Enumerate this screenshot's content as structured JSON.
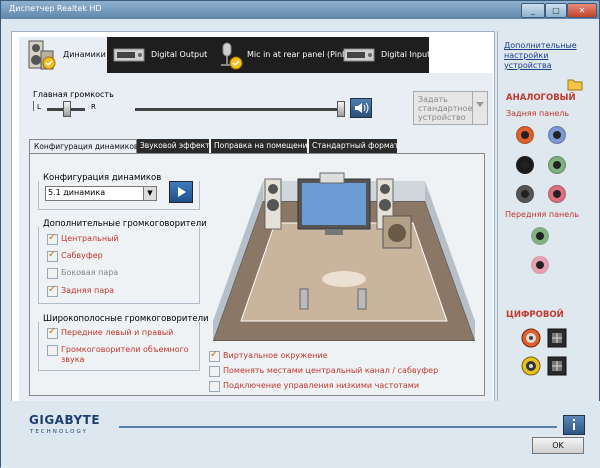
{
  "window": {
    "title": "Диспетчер Realtek HD",
    "buttons": {
      "minimize": "_",
      "maximize": "□",
      "close": "✕"
    }
  },
  "device_tabs": [
    {
      "label": "Динамики",
      "icon": "speakers-icon",
      "active": true
    },
    {
      "label": "Digital Output",
      "icon": "digital-output-device-icon",
      "active": false
    },
    {
      "label": "Mic in at rear panel (Pink)",
      "icon": "microphone-icon",
      "active": false
    },
    {
      "label": "Digital Input",
      "icon": "digital-input-device-icon",
      "active": false
    }
  ],
  "volume": {
    "label": "Главная громкость",
    "left_label": "L",
    "right_label": "R",
    "balance": 0.5,
    "level": 1.0,
    "mute_icon": "speaker-volume-icon",
    "default_device_label": "Задать стандартное устройство"
  },
  "sub_tabs": [
    {
      "label": "Конфигурация динамиков",
      "active": true
    },
    {
      "label": "Звуковой эффект",
      "active": false
    },
    {
      "label": "Поправка на помещение",
      "active": false
    },
    {
      "label": "Стандартный формат",
      "active": false
    }
  ],
  "speaker_config": {
    "title": "Конфигурация динамиков",
    "selected": "5.1 динамика",
    "play_icon": "play-icon"
  },
  "additional_speakers": {
    "title": "Дополнительные громкоговорители",
    "items": [
      {
        "label": "Центральный",
        "checked": true,
        "enabled": true
      },
      {
        "label": "Сабвуфер",
        "checked": true,
        "enabled": true
      },
      {
        "label": "Боковая пара",
        "checked": false,
        "enabled": false
      },
      {
        "label": "Задняя пара",
        "checked": true,
        "enabled": true
      }
    ]
  },
  "fullrange_speakers": {
    "title": "Широкополосные громкоговорители",
    "items": [
      {
        "label": "Передние левый и правый",
        "checked": true
      },
      {
        "label": "Громкоговорители объемного звука",
        "checked": false
      }
    ]
  },
  "bottom_options": [
    {
      "label": "Виртуальное окружение",
      "checked": true
    },
    {
      "label": "Поменять местами центральный канал / сабвуфер",
      "checked": false
    },
    {
      "label": "Подключение управления низкими частотами",
      "checked": false
    }
  ],
  "right_panel": {
    "link": "Дополнительные настройки устройства",
    "analog_title": "АНАЛОГОВЫЙ",
    "rear_panel": "Задняя панель",
    "front_panel": "Передняя панель",
    "digital_title": "ЦИФРОВОЙ",
    "rear_jacks": [
      "#e0612b",
      "#7d9ad6",
      "#1a1a1a",
      "#7fb37f",
      "#555555",
      "#e0707f"
    ],
    "front_jacks": [
      "#7fb37f",
      "#e8a0b0"
    ],
    "folder_icon": "folder-icon"
  },
  "footer": {
    "brand": "GIGABYTE",
    "brand_sub": "TECHNOLOGY",
    "ok_label": "OK",
    "info_icon": "info-icon"
  }
}
